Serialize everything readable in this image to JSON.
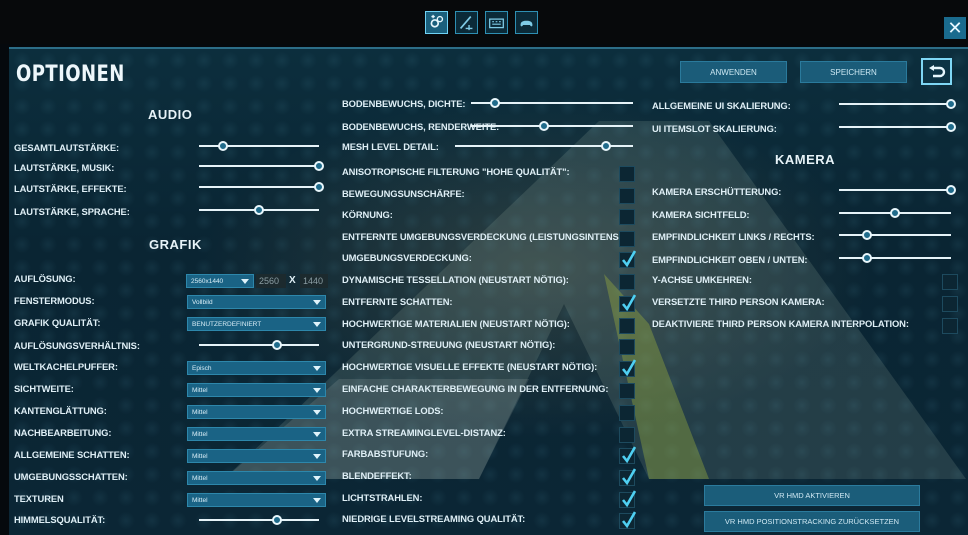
{
  "top_tabs": [
    {
      "name": "general-settings-tab-icon",
      "active": true
    },
    {
      "name": "advanced-settings-tab-icon",
      "active": false
    },
    {
      "name": "keyboard-tab-icon",
      "active": false
    },
    {
      "name": "gamepad-tab-icon",
      "active": false
    }
  ],
  "close_label": "✕",
  "title": "OPTIONEN",
  "header": {
    "apply_label": "ANWENDEN",
    "save_label": "SPEICHERN",
    "back_icon": "undo-arrow-icon"
  },
  "audio": {
    "heading": "AUDIO",
    "sliders": [
      {
        "label": "GESAMTLAUTSTÄRKE:",
        "value": 0.2
      },
      {
        "label": "LAUTSTÄRKE, MUSIK:",
        "value": 1.0
      },
      {
        "label": "LAUTSTÄRKE, EFFEKTE:",
        "value": 1.0
      },
      {
        "label": "LAUTSTÄRKE, SPRACHE:",
        "value": 0.5
      }
    ]
  },
  "graphics": {
    "heading": "GRAFIK",
    "resolution": {
      "label": "AUFLÖSUNG:",
      "selected": "2560x1440",
      "width": "2560",
      "x": "x",
      "height": "1440"
    },
    "dropdowns": [
      {
        "label": "FENSTERMODUS:",
        "value": "Vollbild"
      },
      {
        "label": "GRAFIK QUALITÄT:",
        "value": "BENUTZERDEFINIERT"
      }
    ],
    "scale_slider": {
      "label": "AUFLÖSUNGSVERHÄLTNIS:",
      "value": 0.65
    },
    "dropdowns2": [
      {
        "label": "WELTKACHELPUFFER:",
        "value": "Episch"
      },
      {
        "label": "SICHTWEITE:",
        "value": "Mittel"
      },
      {
        "label": "KANTENGLÄTTUNG:",
        "value": "Mittel"
      },
      {
        "label": "NACHBEARBEITUNG:",
        "value": "Mittel"
      },
      {
        "label": "ALLGEMEINE SCHATTEN:",
        "value": "Mittel"
      },
      {
        "label": "UMGEBUNGSSCHATTEN:",
        "value": "Mittel"
      },
      {
        "label": "TEXTUREN",
        "value": "Mittel"
      }
    ],
    "sky_slider": {
      "label": "HIMMELSQUALITÄT:",
      "value": 0.65
    }
  },
  "middle": {
    "sliders": [
      {
        "label": "BODENBEWUCHS, DICHTE:",
        "value": 0.15
      },
      {
        "label": "BODENBEWUCHS, RENDERWEITE:",
        "value": 0.45
      },
      {
        "label": "MESH LEVEL DETAIL:",
        "value": 0.85
      }
    ],
    "checks": [
      {
        "label": "ANISOTROPISCHE FILTERUNG \"HOHE QUALITÄT\":",
        "checked": false
      },
      {
        "label": "BEWEGUNGSUNSCHÄRFE:",
        "checked": false
      },
      {
        "label": "KÖRNUNG:",
        "checked": false
      },
      {
        "label": "ENTFERNTE UMGEBUNGSVERDECKUNG (LEISTUNGSINTENSIV):",
        "checked": false
      },
      {
        "label": "UMGEBUNGSVERDECKUNG:",
        "checked": true
      },
      {
        "label": "DYNAMISCHE TESSELLATION (NEUSTART NÖTIG):",
        "checked": false
      },
      {
        "label": "ENTFERNTE SCHATTEN:",
        "checked": true
      },
      {
        "label": "HOCHWERTIGE MATERIALIEN (NEUSTART NÖTIG):",
        "checked": false
      },
      {
        "label": "UNTERGRUND-STREUUNG (NEUSTART NÖTIG):",
        "checked": false
      },
      {
        "label": "HOCHWERTIGE VISUELLE EFFEKTE (NEUSTART NÖTIG):",
        "checked": true
      },
      {
        "label": "EINFACHE CHARAKTERBEWEGUNG IN DER ENTFERNUNG:",
        "checked": false
      },
      {
        "label": "HOCHWERTIGE LODs:",
        "checked": false
      },
      {
        "label": "EXTRA STREAMINGLEVEL-DISTANZ:",
        "checked": false
      },
      {
        "label": "FARBABSTUFUNG:",
        "checked": true
      },
      {
        "label": "BLENDEFFEKT:",
        "checked": true
      },
      {
        "label": "LICHTSTRAHLEN:",
        "checked": true
      },
      {
        "label": "NIEDRIGE LEVELSTREAMING QUALITÄT:",
        "checked": true
      }
    ]
  },
  "right": {
    "sliders": [
      {
        "label": "ALLGEMEINE UI SKALIERUNG:",
        "value": 1.0
      },
      {
        "label": "UI ITEMSLOT SKALIERUNG:",
        "value": 1.0
      }
    ],
    "camera_heading": "KAMERA",
    "camera_sliders": [
      {
        "label": "KAMERA ERSCHÜTTERUNG:",
        "value": 1.0
      },
      {
        "label": "KAMERA SICHTFELD:",
        "value": 0.5
      },
      {
        "label": "EMPFINDLICHKEIT LINKS / RECHTS:",
        "value": 0.25
      },
      {
        "label": "EMPFINDLICHKEIT OBEN / UNTEN:",
        "value": 0.25
      }
    ],
    "camera_checks": [
      {
        "label": "Y-ACHSE UMKEHREN:",
        "checked": false
      },
      {
        "label": "VERSETZTE THIRD PERSON KAMERA:",
        "checked": false
      },
      {
        "label": "DEAKTIVIERE THIRD PERSON KAMERA INTERPOLATION:",
        "checked": false
      }
    ],
    "vr_enable_label": "VR HMD AKTIVIEREN",
    "vr_reset_label": "VR HMD POSITIONSTRACKING ZURÜCKSETZEN"
  }
}
